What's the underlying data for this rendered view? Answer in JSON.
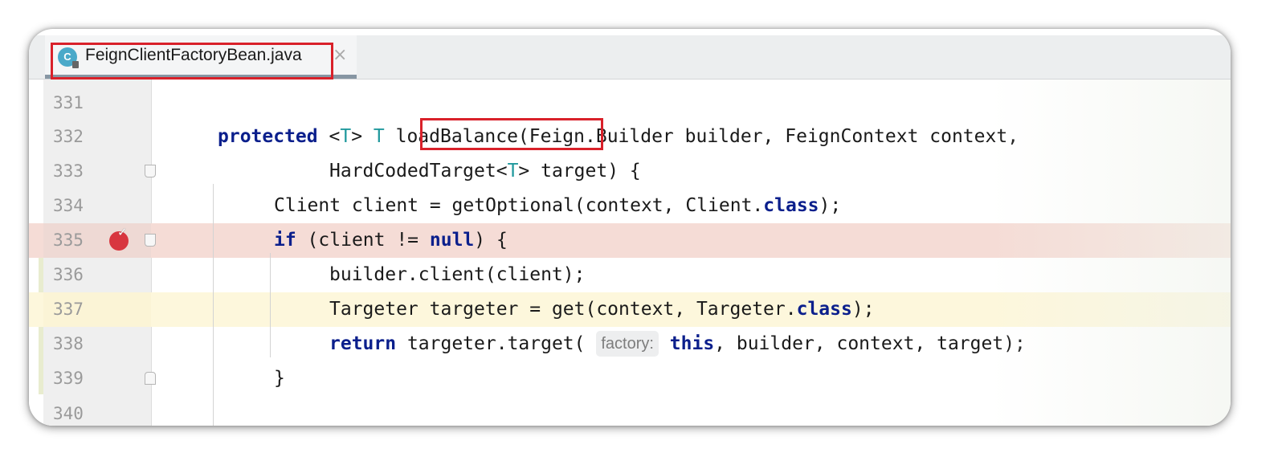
{
  "tab": {
    "icon_letter": "C",
    "title": "FeignClientFactoryBean.java",
    "close_glyph": "×"
  },
  "editor": {
    "hint_label": "factory:",
    "lines": [
      {
        "num": "331"
      },
      {
        "num": "332"
      },
      {
        "num": "333"
      },
      {
        "num": "334"
      },
      {
        "num": "335"
      },
      {
        "num": "336"
      },
      {
        "num": "337"
      },
      {
        "num": "338"
      },
      {
        "num": "339"
      },
      {
        "num": "340"
      }
    ],
    "code": {
      "l332_kw": "protected",
      "l332_gen_open": " <",
      "l332_T1": "T",
      "l332_gen_close": "> ",
      "l332_T2": "T",
      "l332_method": " loadBalance",
      "l332_rest": "(Feign.Builder builder, FeignContext context,",
      "l333_pre": "HardCodedTarget<",
      "l333_T": "T",
      "l333_post": "> target) {",
      "l334_pre": "Client client = getOptional(context, Client.",
      "l334_kw": "class",
      "l334_post": ");",
      "l335_kw1": "if",
      "l335_mid": " (client != ",
      "l335_kw2": "null",
      "l335_post": ") {",
      "l336": "builder.client(client);",
      "l337_pre": "Targeter targeter = get(context, Targeter.",
      "l337_kw": "class",
      "l337_post": ");",
      "l338_kw": "return",
      "l338_pre": " targeter.target( ",
      "l338_kw2": "this",
      "l338_post": ", builder, context, target);",
      "l339": "}"
    }
  },
  "colors": {
    "keyword": "#0b1f8c",
    "type_param": "#20999d",
    "breakpoint_line": "#f5dcd6",
    "current_line": "#fdf7dc",
    "highlight_box": "#d9212a"
  }
}
